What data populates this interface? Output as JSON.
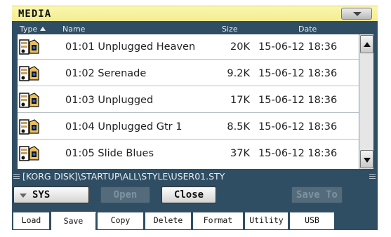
{
  "title": "MEDIA",
  "header": {
    "type": "Type",
    "name": "Name",
    "size": "Size",
    "date": "Date"
  },
  "files": [
    {
      "name": "01:01 Unplugged Heaven",
      "size": "20K",
      "date": "15-06-12 18:36",
      "icon": "style-file-icon"
    },
    {
      "name": "01:02 Serenade",
      "size": "9.2K",
      "date": "15-06-12 18:36",
      "icon": "style-file-icon"
    },
    {
      "name": "01:03 Unplugged",
      "size": "17K",
      "date": "15-06-12 18:36",
      "icon": "style-file-icon"
    },
    {
      "name": "01:04 Unplugged Gtr 1",
      "size": "8.5K",
      "date": "15-06-12 18:36",
      "icon": "style-file-icon"
    },
    {
      "name": "01:05 Slide Blues",
      "size": "37K",
      "date": "15-06-12 18:36",
      "icon": "style-file-icon"
    }
  ],
  "path": "[KORG DISK]\\STARTUP\\ALL\\STYLE\\USER01.STY",
  "buttons": {
    "sys": "SYS",
    "open": "Open",
    "close": "Close",
    "save_to": "Save To"
  },
  "tabs": [
    "Load",
    "Save",
    "Copy",
    "Delete",
    "Format",
    "Utility",
    "USB"
  ],
  "active_tab": "Save",
  "colors": {
    "panel": "#2f4e63",
    "title_bar": "#f5ef9c"
  }
}
